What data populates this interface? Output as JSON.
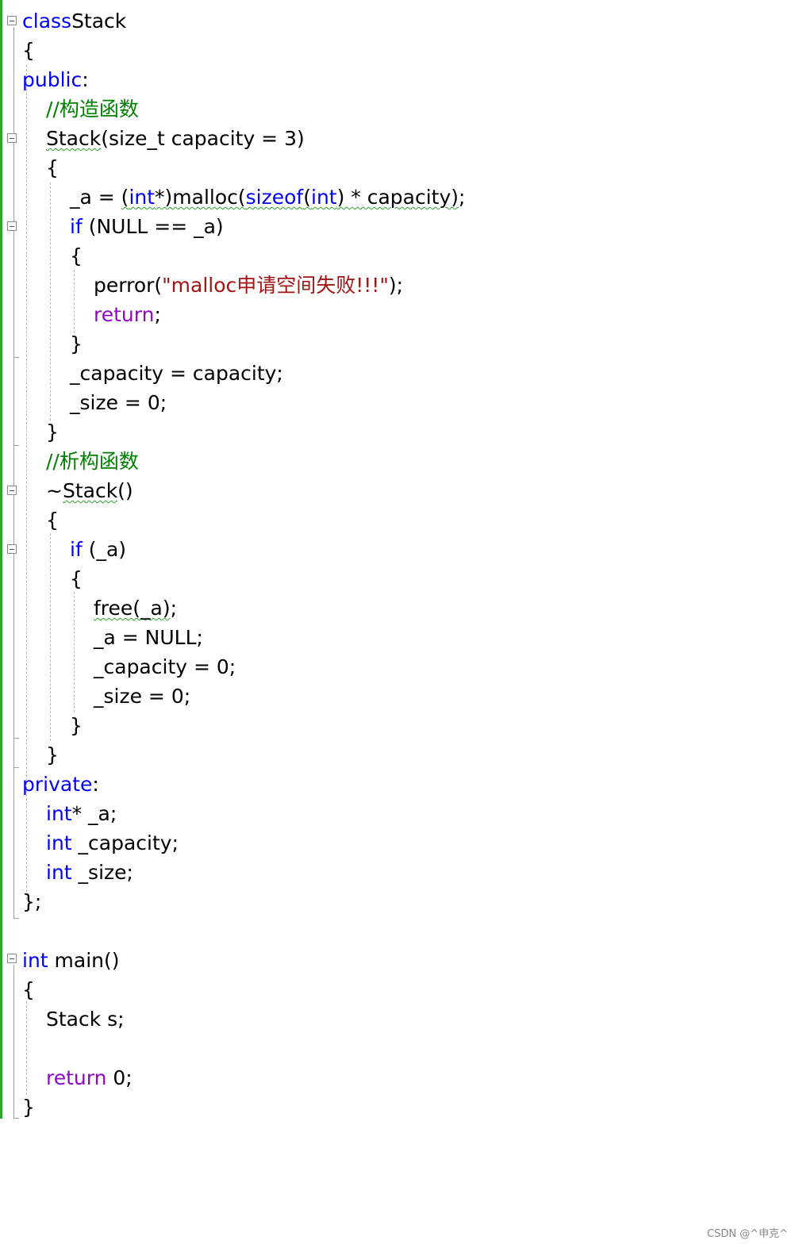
{
  "editor": {
    "lines": [
      {
        "t": [
          [
            "kw",
            "class"
          ],
          [
            "",
            "Stack"
          ]
        ]
      },
      {
        "t": [
          [
            "",
            "{"
          ]
        ]
      },
      {
        "t": [
          [
            "kw",
            "public"
          ],
          [
            "",
            ":"
          ]
        ]
      },
      {
        "t": [
          [
            "cm",
            "//构造函数"
          ]
        ]
      },
      {
        "t": [
          [
            "sq",
            "Stack"
          ],
          [
            "",
            "(size_t capacity = 3)"
          ]
        ]
      },
      {
        "t": [
          [
            "",
            "{"
          ]
        ]
      },
      {
        "t": [
          [
            "",
            "_a = "
          ],
          [
            "sq",
            "("
          ],
          [
            "sqkw",
            "int"
          ],
          [
            "sq",
            "*)malloc("
          ],
          [
            "sqkw",
            "sizeof"
          ],
          [
            "sq",
            "("
          ],
          [
            "sqkw",
            "int"
          ],
          [
            "sq",
            ") * capacity)"
          ],
          [
            "",
            ";"
          ]
        ]
      },
      {
        "t": [
          [
            "kw",
            "if"
          ],
          [
            "",
            " (NULL == _a)"
          ]
        ]
      },
      {
        "t": [
          [
            "",
            "{"
          ]
        ]
      },
      {
        "t": [
          [
            "",
            "perror("
          ],
          [
            "st",
            "\"malloc申请空间失败!!!\""
          ],
          [
            "",
            ");"
          ]
        ]
      },
      {
        "t": [
          [
            "kw2",
            "return"
          ],
          [
            "",
            ";"
          ]
        ]
      },
      {
        "t": [
          [
            "",
            "}"
          ]
        ]
      },
      {
        "t": [
          [
            "",
            "_capacity = capacity;"
          ]
        ]
      },
      {
        "t": [
          [
            "",
            "_size = 0;"
          ]
        ]
      },
      {
        "t": [
          [
            "",
            "}"
          ]
        ]
      },
      {
        "t": [
          [
            "cm",
            "//析构函数"
          ]
        ]
      },
      {
        "t": [
          [
            "",
            "~"
          ],
          [
            "sq",
            "Stack"
          ],
          [
            "",
            "()"
          ]
        ]
      },
      {
        "t": [
          [
            "",
            "{"
          ]
        ]
      },
      {
        "t": [
          [
            "kw",
            "if"
          ],
          [
            "",
            " (_a)"
          ]
        ]
      },
      {
        "t": [
          [
            "",
            "{"
          ]
        ]
      },
      {
        "t": [
          [
            "sq",
            "free(_a)"
          ],
          [
            "",
            ";"
          ]
        ]
      },
      {
        "t": [
          [
            "",
            "_a = NULL;"
          ]
        ]
      },
      {
        "t": [
          [
            "",
            "_capacity = 0;"
          ]
        ]
      },
      {
        "t": [
          [
            "",
            "_size = 0;"
          ]
        ]
      },
      {
        "t": [
          [
            "",
            "}"
          ]
        ]
      },
      {
        "t": [
          [
            "",
            "}"
          ]
        ]
      },
      {
        "t": [
          [
            "kw",
            "private"
          ],
          [
            "",
            ":"
          ]
        ]
      },
      {
        "t": [
          [
            "kw",
            "int"
          ],
          [
            "",
            "* _a;"
          ]
        ]
      },
      {
        "t": [
          [
            "kw",
            "int"
          ],
          [
            "",
            " _capacity;"
          ]
        ]
      },
      {
        "t": [
          [
            "kw",
            "int"
          ],
          [
            "",
            " _size;"
          ]
        ]
      },
      {
        "t": [
          [
            "",
            "};"
          ]
        ]
      },
      {
        "t": []
      },
      {
        "t": [
          [
            "kw",
            "int"
          ],
          [
            "",
            " main()"
          ]
        ]
      },
      {
        "t": [
          [
            "",
            "{"
          ]
        ]
      },
      {
        "t": [
          [
            "",
            "Stack s;"
          ]
        ]
      },
      {
        "t": []
      },
      {
        "t": [
          [
            "kw2",
            "return"
          ],
          [
            "",
            " 0;"
          ]
        ]
      },
      {
        "t": [
          [
            "",
            "}"
          ]
        ]
      }
    ]
  },
  "colors": {
    "keyword": "#0000ff",
    "control_keyword": "#8f08c4",
    "comment": "#008000",
    "string": "#a31515",
    "squiggle": "#2aa52a",
    "margin_bar": "#2aa52a"
  },
  "watermark": "CSDN @^申克^"
}
